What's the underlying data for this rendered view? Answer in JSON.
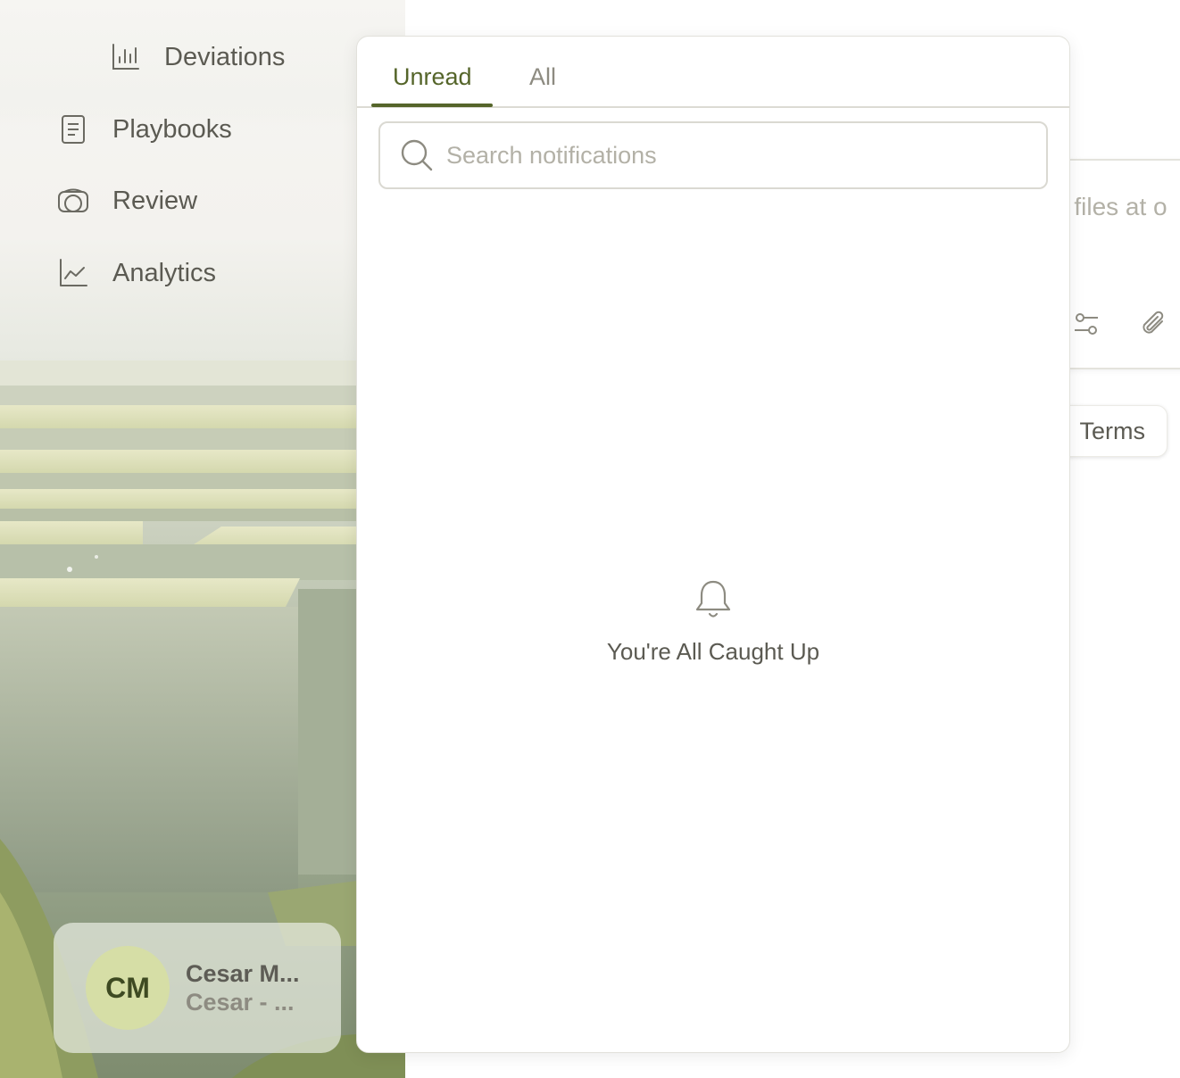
{
  "sidebar": {
    "items": [
      {
        "label": "Deviations",
        "icon": "bar-chart-icon"
      },
      {
        "label": "Playbooks",
        "icon": "document-icon"
      },
      {
        "label": "Review",
        "icon": "review-icon"
      },
      {
        "label": "Analytics",
        "icon": "line-chart-icon"
      }
    ],
    "profile": {
      "initials": "CM",
      "name": "Cesar M...",
      "subtitle": "Cesar - ..."
    }
  },
  "main": {
    "compose_placeholder": "e files at o",
    "terms_chip": "Terms"
  },
  "notifications": {
    "tabs": [
      {
        "label": "Unread",
        "active": true
      },
      {
        "label": "All",
        "active": false
      }
    ],
    "search_placeholder": "Search notifications",
    "empty_title": "You're All Caught Up"
  },
  "colors": {
    "accent": "#55652a",
    "text_primary": "#5b5a52",
    "text_muted": "#8d8b81",
    "avatar_bg": "#d6dea6"
  }
}
